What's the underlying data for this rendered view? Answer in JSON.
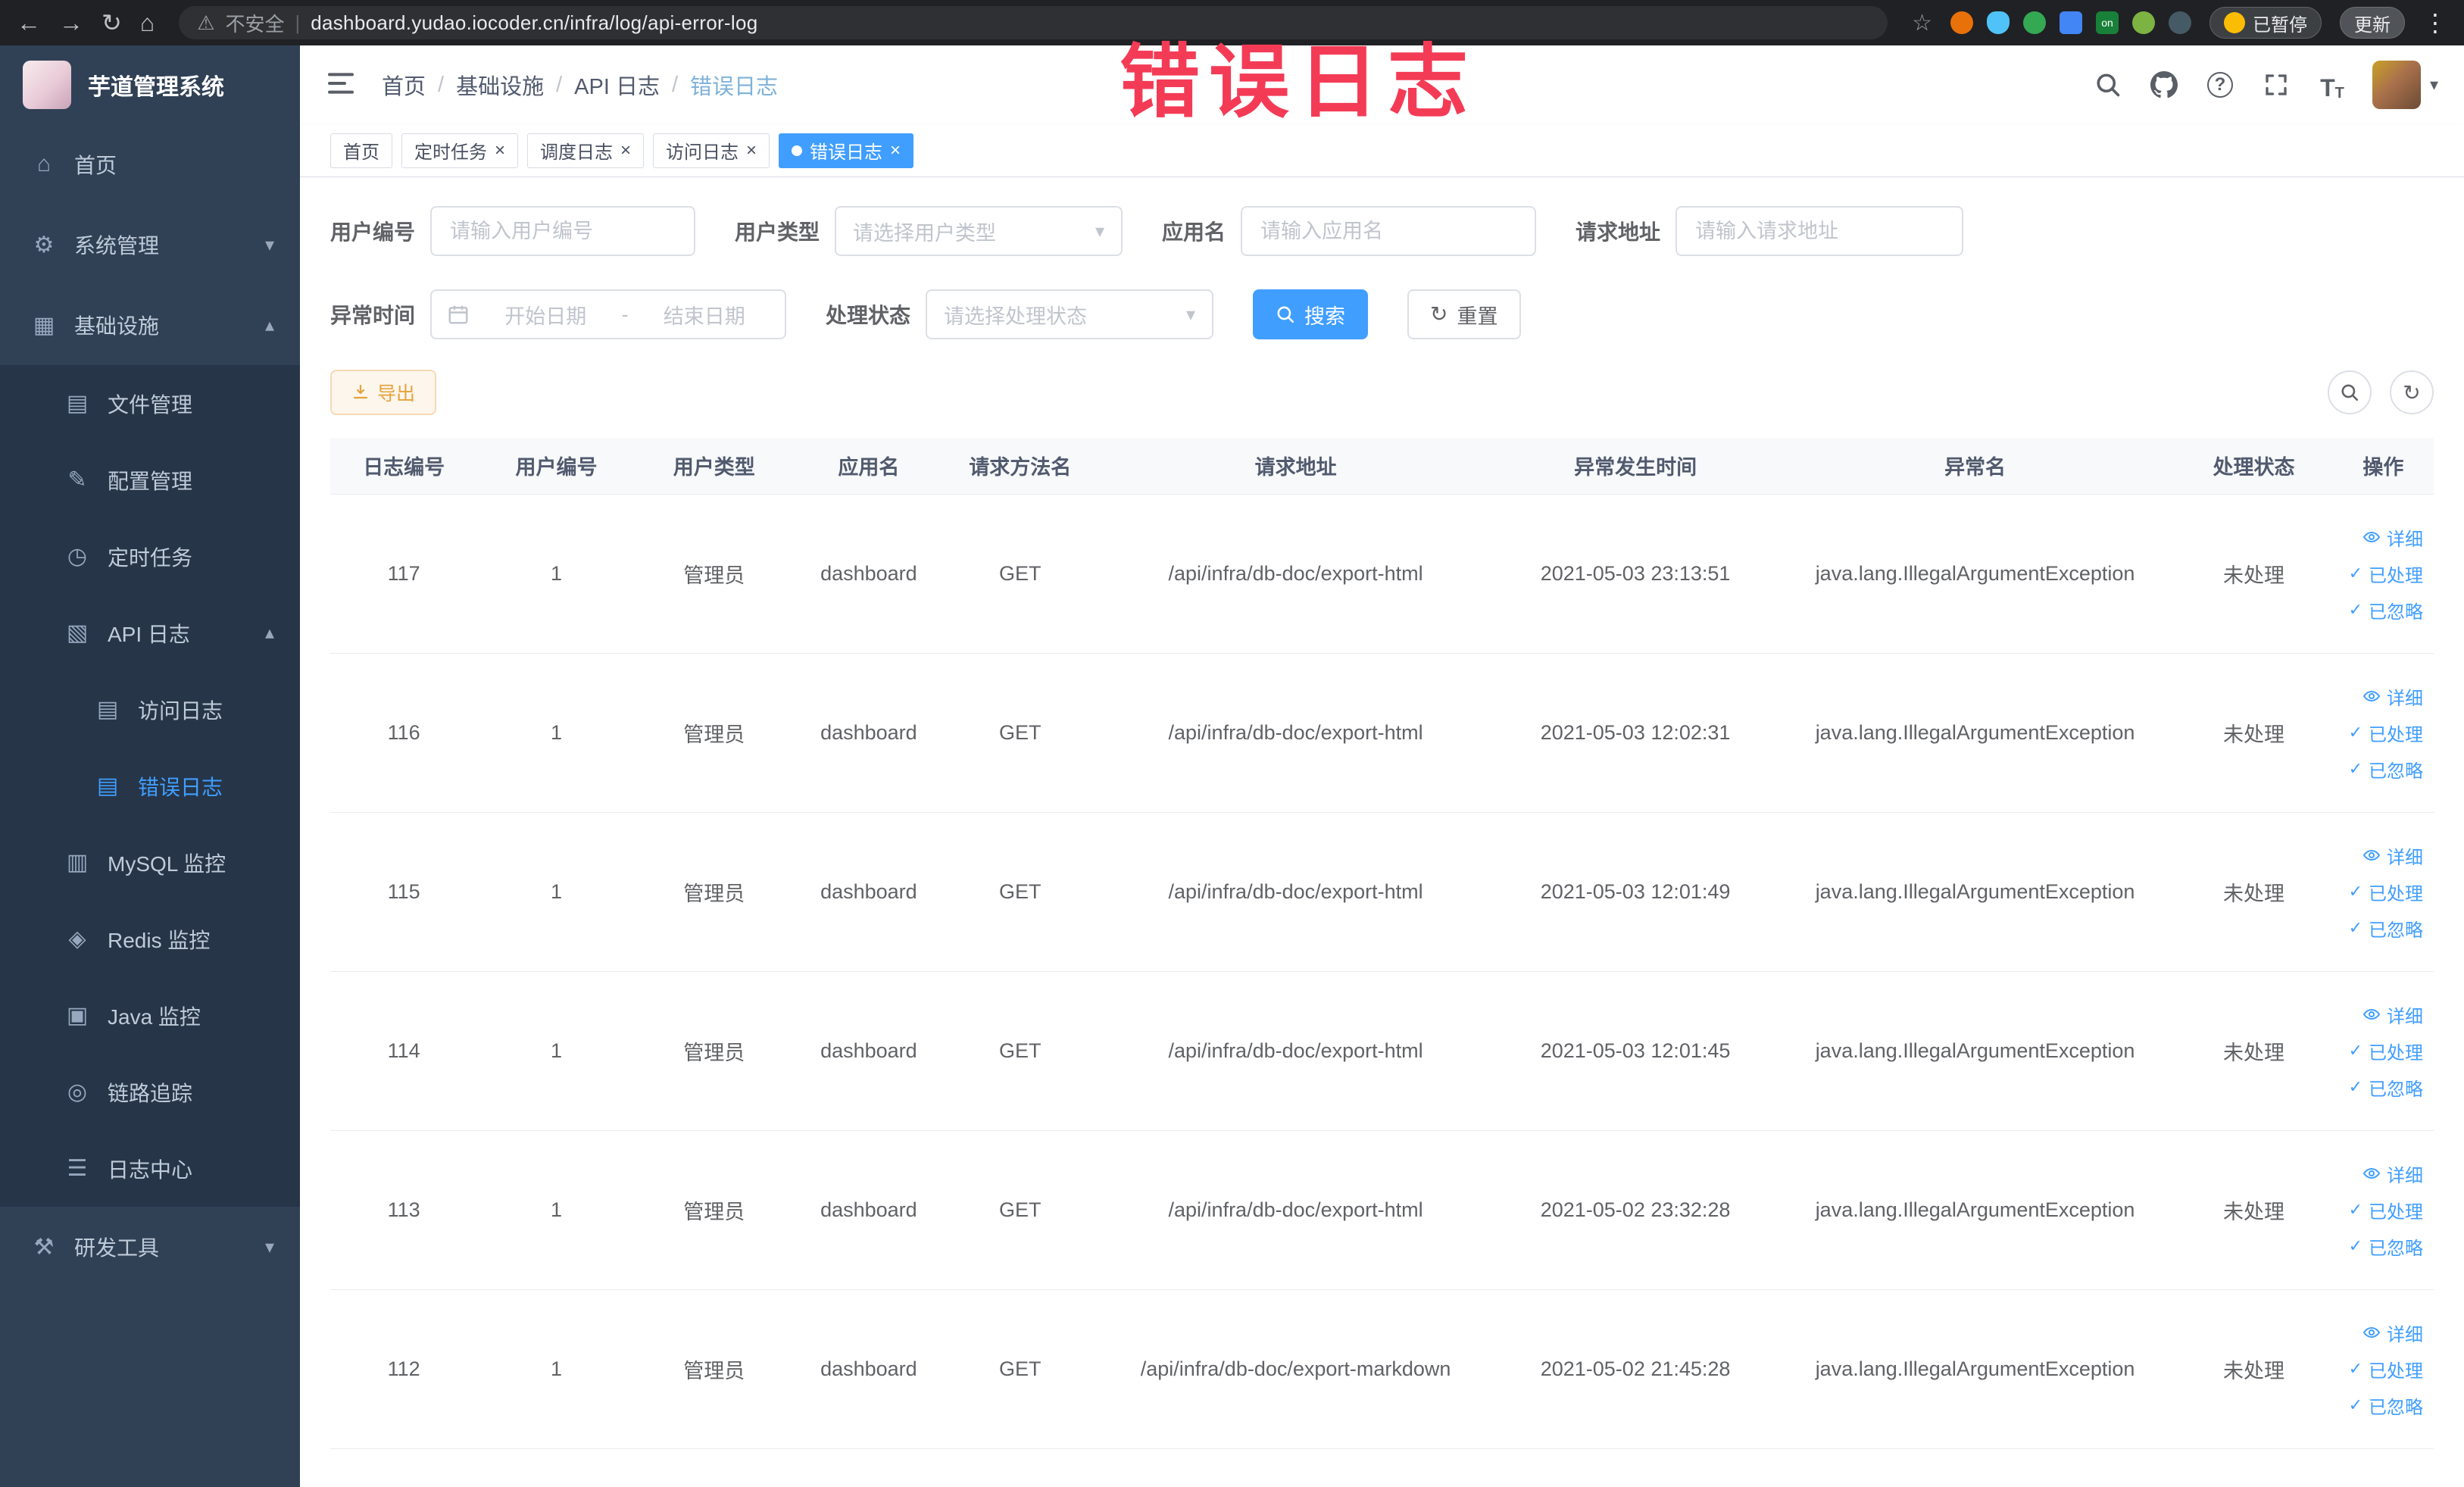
{
  "colors": {
    "accent": "#409eff",
    "warning": "#e6a23c",
    "sidebar_bg": "#304156",
    "annotation": "#f43b56"
  },
  "browser": {
    "security_label": "不安全",
    "url": "dashboard.yudao.iocoder.cn/infra/log/api-error-log",
    "paused_badge": "已暂停",
    "update_button": "更新",
    "extension_on_badge": "on"
  },
  "annotation": {
    "text": "错误日志",
    "color": "#f43b56"
  },
  "icons": {
    "back": "←",
    "forward": "→",
    "reload": "↻",
    "home": "⌂",
    "warning": "⚠",
    "star": "☆",
    "more": "⋮",
    "pipe": "|",
    "gear": "⚙",
    "infra": "▦",
    "file": "▤",
    "config": "✎",
    "clock": "◷",
    "api_log": "▧",
    "doc": "▤",
    "mysql": "▥",
    "redis": "◈",
    "java": "▣",
    "trace": "◎",
    "log_center": "☰",
    "tools": "⚒",
    "chevron_down": "▾",
    "chevron_up": "▴",
    "caret_down": "▾",
    "refresh": "↻",
    "check": "✓",
    "close": "×",
    "question": "?",
    "font": "T"
  },
  "sidebar": {
    "logo_title": "芋道管理系统",
    "items": [
      {
        "label": "首页"
      },
      {
        "label": "系统管理"
      },
      {
        "label": "基础设施"
      },
      {
        "label": "文件管理"
      },
      {
        "label": "配置管理"
      },
      {
        "label": "定时任务"
      },
      {
        "label": "API 日志"
      },
      {
        "label": "访问日志"
      },
      {
        "label": "错误日志"
      },
      {
        "label": "MySQL 监控"
      },
      {
        "label": "Redis 监控"
      },
      {
        "label": "Java 监控"
      },
      {
        "label": "链路追踪"
      },
      {
        "label": "日志中心"
      },
      {
        "label": "研发工具"
      }
    ]
  },
  "header": {
    "separator": "/",
    "breadcrumb": [
      "首页",
      "基础设施",
      "API 日志",
      "错误日志"
    ]
  },
  "tags": [
    {
      "label": "首页"
    },
    {
      "label": "定时任务"
    },
    {
      "label": "调度日志"
    },
    {
      "label": "访问日志"
    },
    {
      "label": "错误日志"
    }
  ],
  "filters": {
    "user_id": {
      "label": "用户编号",
      "placeholder": "请输入用户编号"
    },
    "user_type": {
      "label": "用户类型",
      "placeholder": "请选择用户类型"
    },
    "app_name": {
      "label": "应用名",
      "placeholder": "请输入应用名"
    },
    "request_url": {
      "label": "请求地址",
      "placeholder": "请输入请求地址"
    },
    "exception_time": {
      "label": "异常时间",
      "start_placeholder": "开始日期",
      "separator": "-",
      "end_placeholder": "结束日期"
    },
    "process_status": {
      "label": "处理状态",
      "placeholder": "请选择处理状态"
    },
    "search_button": "搜索",
    "reset_button": "重置"
  },
  "toolbar": {
    "export_button": "导出"
  },
  "table": {
    "headers": [
      "日志编号",
      "用户编号",
      "用户类型",
      "应用名",
      "请求方法名",
      "请求地址",
      "异常发生时间",
      "异常名",
      "处理状态",
      "操作"
    ],
    "actions": {
      "detail": "详细",
      "processed": "已处理",
      "ignored": "已忽略"
    },
    "rows": [
      {
        "id": "117",
        "user_id": "1",
        "user_type": "管理员",
        "app": "dashboard",
        "method": "GET",
        "url": "/api/infra/db-doc/export-html",
        "time": "2021-05-03 23:13:51",
        "exception": "java.lang.IllegalArgumentException",
        "status": "未处理"
      },
      {
        "id": "116",
        "user_id": "1",
        "user_type": "管理员",
        "app": "dashboard",
        "method": "GET",
        "url": "/api/infra/db-doc/export-html",
        "time": "2021-05-03 12:02:31",
        "exception": "java.lang.IllegalArgumentException",
        "status": "未处理"
      },
      {
        "id": "115",
        "user_id": "1",
        "user_type": "管理员",
        "app": "dashboard",
        "method": "GET",
        "url": "/api/infra/db-doc/export-html",
        "time": "2021-05-03 12:01:49",
        "exception": "java.lang.IllegalArgumentException",
        "status": "未处理"
      },
      {
        "id": "114",
        "user_id": "1",
        "user_type": "管理员",
        "app": "dashboard",
        "method": "GET",
        "url": "/api/infra/db-doc/export-html",
        "time": "2021-05-03 12:01:45",
        "exception": "java.lang.IllegalArgumentException",
        "status": "未处理"
      },
      {
        "id": "113",
        "user_id": "1",
        "user_type": "管理员",
        "app": "dashboard",
        "method": "GET",
        "url": "/api/infra/db-doc/export-html",
        "time": "2021-05-02 23:32:28",
        "exception": "java.lang.IllegalArgumentException",
        "status": "未处理"
      },
      {
        "id": "112",
        "user_id": "1",
        "user_type": "管理员",
        "app": "dashboard",
        "method": "GET",
        "url": "/api/infra/db-doc/export-markdown",
        "time": "2021-05-02 21:45:28",
        "exception": "java.lang.IllegalArgumentException",
        "status": "未处理"
      }
    ]
  }
}
